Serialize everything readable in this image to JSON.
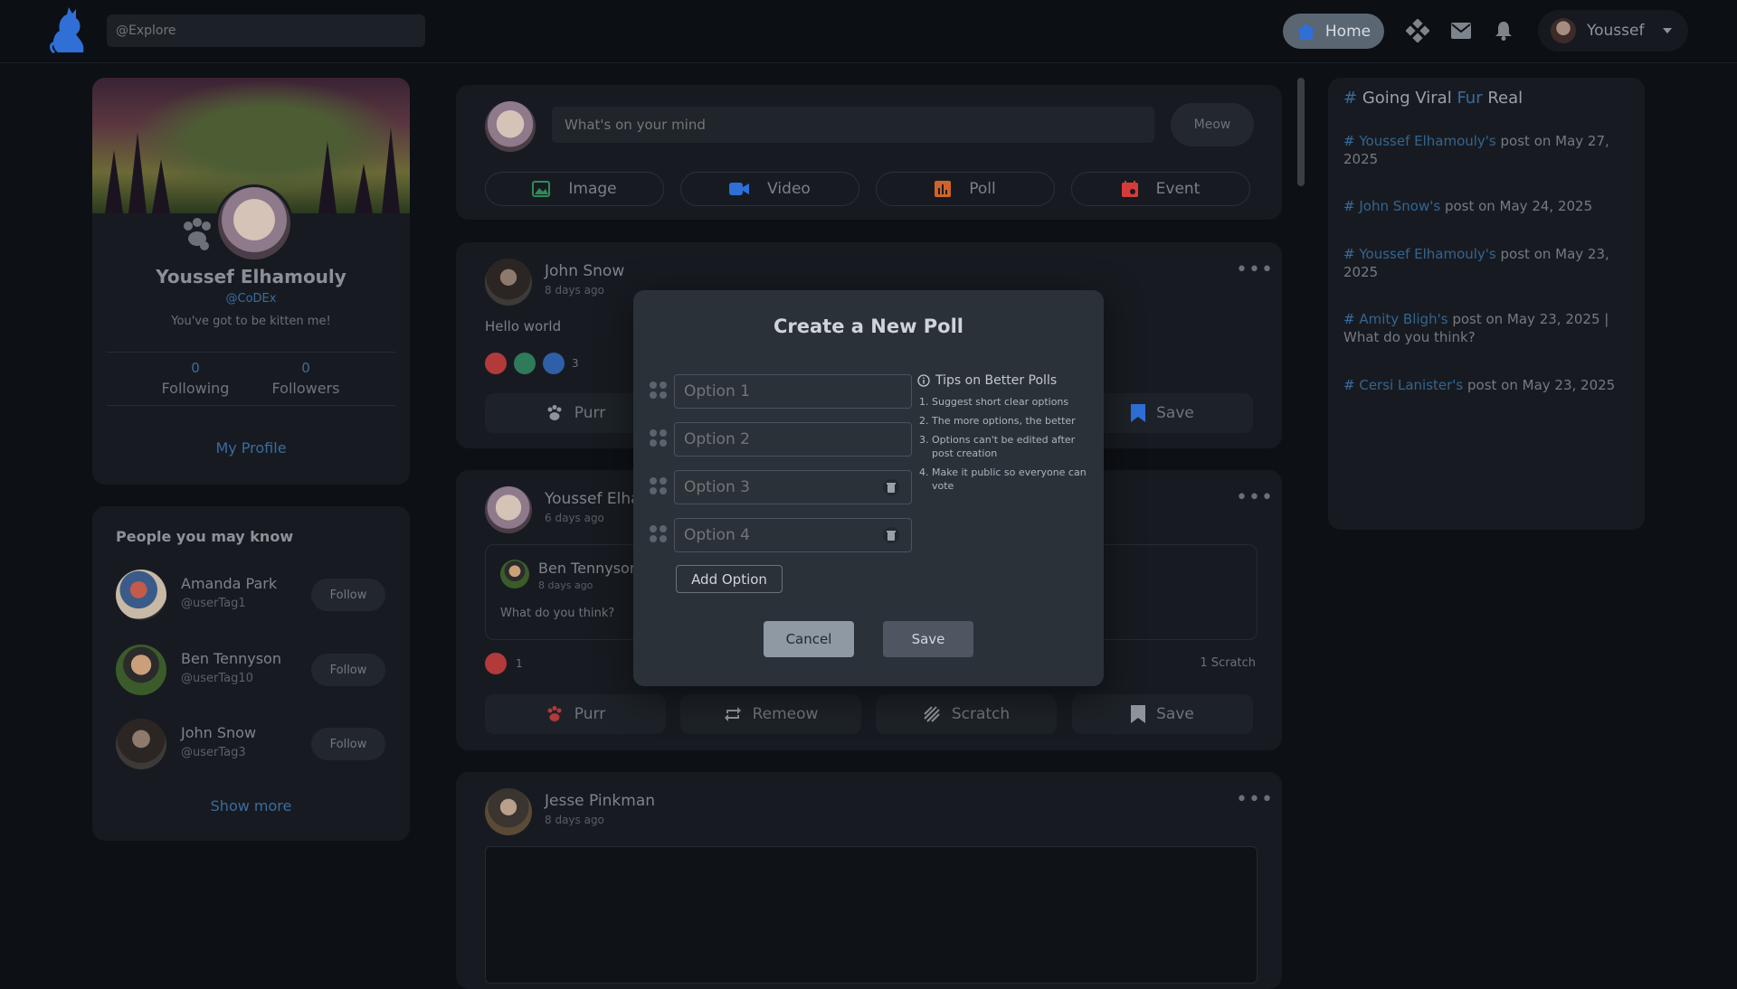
{
  "topbar": {
    "search_placeholder": "@Explore",
    "home_label": "Home",
    "user_name": "Youssef"
  },
  "profile": {
    "name": "Youssef Elhamouly",
    "handle": "@CoDEx",
    "bio": "You've got to be kitten me!",
    "following_count": "0",
    "following_label": "Following",
    "followers_count": "0",
    "followers_label": "Followers",
    "my_profile_label": "My Profile"
  },
  "people": {
    "title": "People you may know",
    "follow_label": "Follow",
    "show_more_label": "Show more",
    "items": [
      {
        "name": "Amanda Park",
        "tag": "@userTag1"
      },
      {
        "name": "Ben Tennyson",
        "tag": "@userTag10"
      },
      {
        "name": "John Snow",
        "tag": "@userTag3"
      }
    ]
  },
  "composer": {
    "placeholder": "What's on your mind",
    "meow_label": "Meow",
    "buttons": [
      {
        "label": "Image",
        "color": "#2e8b57",
        "icon": "image-icon"
      },
      {
        "label": "Video",
        "color": "#2f6fd6",
        "icon": "video-icon"
      },
      {
        "label": "Poll",
        "color": "#d0632a",
        "icon": "poll-icon"
      },
      {
        "label": "Event",
        "color": "#d63b3b",
        "icon": "event-icon"
      }
    ]
  },
  "posts": [
    {
      "author": "John Snow",
      "time": "8 days ago",
      "text": "Hello world",
      "reaction_count": "3",
      "actions": {
        "purr": "Purr",
        "save": "Save"
      }
    },
    {
      "author": "Youssef Elha",
      "time": "6 days ago",
      "quoted_author": "Ben Tennyson",
      "quoted_time": "8 days ago",
      "quoted_text": "What do you think?",
      "reaction_count": "1",
      "scratch_count": "1 Scratch",
      "actions": {
        "purr": "Purr",
        "remeow": "Remeow",
        "scratch": "Scratch",
        "save": "Save"
      }
    },
    {
      "author": "Jesse Pinkman",
      "time": "8 days ago"
    }
  ],
  "viral": {
    "title_hash": "#",
    "title_a": "Going Viral",
    "title_b": "Fur",
    "title_c": "Real",
    "items": [
      {
        "link": "Youssef Elhamouly's",
        "rest": "post on May 27, 2025"
      },
      {
        "link": "John Snow's",
        "rest": "post on May 24, 2025"
      },
      {
        "link": "Youssef Elhamouly's",
        "rest": "post on May 23, 2025"
      },
      {
        "link": "Amity Bligh's",
        "rest": "post on May 23, 2025 | What do you think?"
      },
      {
        "link": "Cersi Lanister's",
        "rest": "post on May 23, 2025"
      }
    ]
  },
  "modal": {
    "title": "Create a New Poll",
    "options": [
      "Option 1",
      "Option 2",
      "Option 3",
      "Option 4"
    ],
    "add_option_label": "Add Option",
    "tips_title": "Tips on Better Polls",
    "tips": [
      "Suggest short clear options",
      "The more options, the better",
      "Options can't be edited after post creation",
      "Make it public so everyone can vote"
    ],
    "cancel_label": "Cancel",
    "save_label": "Save"
  }
}
